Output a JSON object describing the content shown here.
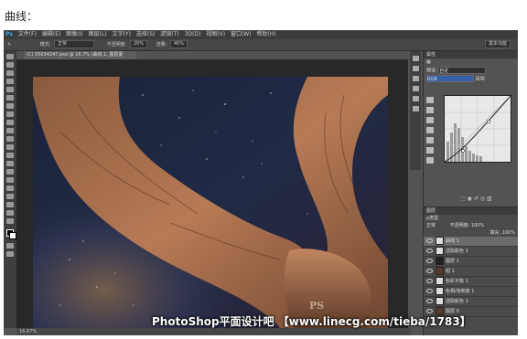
{
  "caption": "曲线：",
  "app": {
    "logo": "Ps",
    "menu": [
      "文件(F)",
      "编辑(E)",
      "图像(I)",
      "图层(L)",
      "文字(Y)",
      "选择(S)",
      "滤镜(T)",
      "3D(D)",
      "视图(V)",
      "窗口(W)",
      "帮助(H)"
    ],
    "workspace": "基本功能"
  },
  "options": {
    "mode_label": "模式:",
    "mode_value": "正常",
    "opacity_label": "不透明度:",
    "opacity_value": "20%",
    "flow_label": "流量:",
    "flow_value": "40%"
  },
  "document": {
    "tab": "(C) 05034247.psd @ 16.7% (曲线 1, 图层蒙版/16) *",
    "zoom": "16.67%"
  },
  "properties": {
    "header": "属性",
    "preset_label": "预设:",
    "preset_value": "自定",
    "channel_value": "RGB",
    "auto_label": "自动"
  },
  "layers": {
    "header": "图层",
    "kind_label": "ρ类型",
    "blend_value": "正常",
    "opacity_label": "不透明度:",
    "opacity_value": "100%",
    "fill_label": "填充:",
    "fill_value": "100%",
    "items": [
      {
        "name": "曲线 1",
        "active": true,
        "thumb": "light"
      },
      {
        "name": "选取颜色 1",
        "active": false,
        "thumb": "light"
      },
      {
        "name": "图层 1",
        "active": false,
        "thumb": "dark"
      },
      {
        "name": "组 1",
        "active": false,
        "thumb": "pic"
      },
      {
        "name": "色彩平衡 1",
        "active": false,
        "thumb": "light"
      },
      {
        "name": "色相/饱和度 1",
        "active": false,
        "thumb": "light"
      },
      {
        "name": "选取颜色 1",
        "active": false,
        "thumb": "light"
      },
      {
        "name": "图层 0",
        "active": false,
        "thumb": "pic"
      }
    ]
  },
  "watermark": "PhotoShop平面设计吧 【www.linecg.com/tieba/1783】",
  "stamp": "PS",
  "colors": {
    "ps_bg": "#535353",
    "menubar": "#3c3c3c",
    "ps_blue": "#31a8ff"
  }
}
